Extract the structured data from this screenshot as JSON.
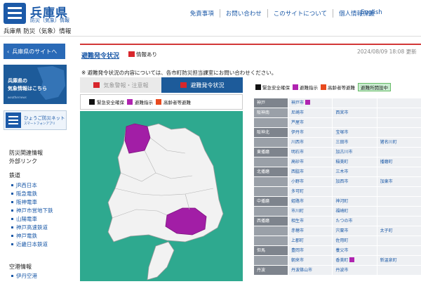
{
  "header": {
    "logo_name": "兵庫県",
    "logo_sub": "防災（気象）情報",
    "site_sub": "兵庫県 防災（気象）情報",
    "nav": [
      "免責事項",
      "お問い合わせ",
      "このサイトについて",
      "個人情報保護"
    ],
    "english": "English"
  },
  "sidebar": {
    "back_button": "兵庫県のサイトへ",
    "banner1_line1": "兵庫県の",
    "banner1_line2": "気象情報はこちら",
    "banner1_sub": "weathernews",
    "banner2_title": "ひょうご防災ネット",
    "banner2_sub": "スマートフォンアプリ",
    "links_head": "防災関連情報",
    "links_head2": "外部リンク",
    "rail_head": "鉄道",
    "rail_items": [
      "JR西日本",
      "阪急電鉄",
      "阪神電車",
      "神戸市営地下鉄",
      "山陽電車",
      "神戸高速鉄道",
      "神戸電鉄",
      "近畿日本鉄道"
    ],
    "air_head": "空港情報",
    "air_items": [
      "伊丹空港"
    ]
  },
  "main": {
    "title": "避難発令状況",
    "flag_label": "情報あり",
    "updated": "2024/08/09 18:08 更新",
    "note": "※ 避難発令状況の内容については、各市町防災担当課室にお問い合わせください。",
    "tab_warn": "気象警報・注意報",
    "tab_evac": "避難発令状況",
    "legend": [
      "緊急安全確保",
      "避難指示",
      "高齢者等避難"
    ],
    "legend_colors": [
      "#111111",
      "#b024b0",
      "#e84a1f"
    ]
  },
  "right": {
    "legend": [
      "緊急安全確保",
      "避難指示",
      "高齢者等避難"
    ],
    "open_label": "避難所開設中",
    "rows": [
      {
        "pref": "神戸",
        "cells": [
          "神戸市",
          "",
          ""
        ],
        "head": true,
        "tag": [
          true,
          false,
          false
        ]
      },
      {
        "pref": "阪神南",
        "cells": [
          "尼崎市",
          "西宮市",
          ""
        ],
        "head": false,
        "tag": [
          false,
          false,
          false
        ]
      },
      {
        "pref": "",
        "cells": [
          "芦屋市",
          "",
          ""
        ],
        "head": false,
        "tag": [
          false,
          false,
          false
        ]
      },
      {
        "pref": "阪神北",
        "cells": [
          "伊丹市",
          "宝塚市",
          ""
        ],
        "head": true,
        "tag": [
          false,
          false,
          false
        ]
      },
      {
        "pref": "",
        "cells": [
          "川西市",
          "三田市",
          "猪名川町"
        ],
        "head": false,
        "tag": [
          false,
          false,
          false
        ]
      },
      {
        "pref": "東播磨",
        "cells": [
          "明石市",
          "加古川市",
          ""
        ],
        "head": true,
        "tag": [
          false,
          false,
          false
        ]
      },
      {
        "pref": "",
        "cells": [
          "高砂市",
          "稲美町",
          "播磨町"
        ],
        "head": false,
        "tag": [
          false,
          false,
          false
        ]
      },
      {
        "pref": "北播磨",
        "cells": [
          "西脇市",
          "三木市",
          ""
        ],
        "head": true,
        "tag": [
          false,
          false,
          false
        ]
      },
      {
        "pref": "",
        "cells": [
          "小野市",
          "加西市",
          "加東市"
        ],
        "head": false,
        "tag": [
          false,
          false,
          false
        ]
      },
      {
        "pref": "",
        "cells": [
          "多可町",
          "",
          ""
        ],
        "head": false,
        "tag": [
          false,
          false,
          false
        ]
      },
      {
        "pref": "中播磨",
        "cells": [
          "姫路市",
          "神河町",
          ""
        ],
        "head": true,
        "tag": [
          false,
          false,
          false
        ]
      },
      {
        "pref": "",
        "cells": [
          "市川町",
          "福崎町",
          ""
        ],
        "head": false,
        "tag": [
          false,
          false,
          false
        ]
      },
      {
        "pref": "西播磨",
        "cells": [
          "相生市",
          "たつの市",
          ""
        ],
        "head": true,
        "tag": [
          false,
          false,
          false
        ]
      },
      {
        "pref": "",
        "cells": [
          "赤穂市",
          "宍粟市",
          "太子町"
        ],
        "head": false,
        "tag": [
          false,
          false,
          false
        ]
      },
      {
        "pref": "",
        "cells": [
          "上郡町",
          "佐用町",
          ""
        ],
        "head": false,
        "tag": [
          false,
          false,
          false
        ]
      },
      {
        "pref": "但馬",
        "cells": [
          "豊岡市",
          "養父市",
          ""
        ],
        "head": true,
        "tag": [
          false,
          false,
          false
        ]
      },
      {
        "pref": "",
        "cells": [
          "朝来市",
          "香美町",
          "新温泉町"
        ],
        "head": false,
        "tag": [
          false,
          true,
          false
        ]
      },
      {
        "pref": "丹波",
        "cells": [
          "丹波篠山市",
          "丹波市",
          ""
        ],
        "head": true,
        "tag": [
          false,
          false,
          false
        ]
      }
    ]
  }
}
